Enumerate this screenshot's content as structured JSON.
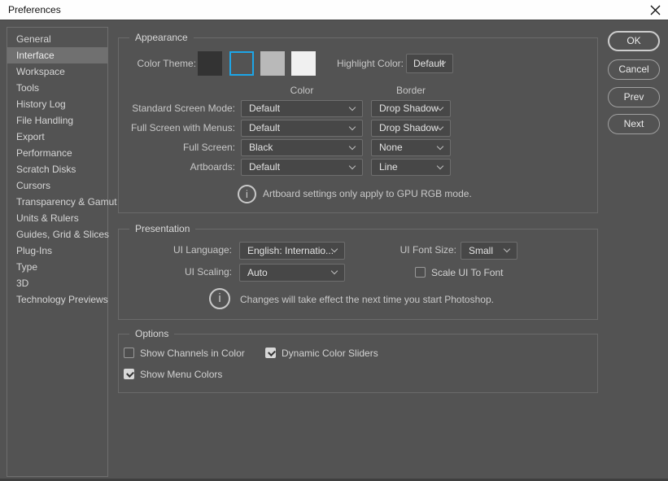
{
  "window": {
    "title": "Preferences"
  },
  "sidebar": {
    "items": [
      {
        "label": "General",
        "selected": false
      },
      {
        "label": "Interface",
        "selected": true
      },
      {
        "label": "Workspace",
        "selected": false
      },
      {
        "label": "Tools",
        "selected": false
      },
      {
        "label": "History Log",
        "selected": false
      },
      {
        "label": "File Handling",
        "selected": false
      },
      {
        "label": "Export",
        "selected": false
      },
      {
        "label": "Performance",
        "selected": false
      },
      {
        "label": "Scratch Disks",
        "selected": false
      },
      {
        "label": "Cursors",
        "selected": false
      },
      {
        "label": "Transparency & Gamut",
        "selected": false
      },
      {
        "label": "Units & Rulers",
        "selected": false
      },
      {
        "label": "Guides, Grid & Slices",
        "selected": false
      },
      {
        "label": "Plug-Ins",
        "selected": false
      },
      {
        "label": "Type",
        "selected": false
      },
      {
        "label": "3D",
        "selected": false
      },
      {
        "label": "Technology Previews",
        "selected": false
      }
    ]
  },
  "buttons": {
    "ok": "OK",
    "cancel": "Cancel",
    "prev": "Prev",
    "next": "Next"
  },
  "appearance": {
    "legend": "Appearance",
    "color_theme_label": "Color Theme:",
    "swatches": [
      "#333333",
      "#535353",
      "#b9b9b9",
      "#f0f0f0"
    ],
    "selected_swatch_index": 1,
    "selection_color": "#1da6e8",
    "highlight_color_label": "Highlight Color:",
    "highlight_color_value": "Default",
    "columns": {
      "color": "Color",
      "border": "Border"
    },
    "rows": [
      {
        "label": "Standard Screen Mode:",
        "color": "Default",
        "border": "Drop Shadow"
      },
      {
        "label": "Full Screen with Menus:",
        "color": "Default",
        "border": "Drop Shadow"
      },
      {
        "label": "Full Screen:",
        "color": "Black",
        "border": "None"
      },
      {
        "label": "Artboards:",
        "color": "Default",
        "border": "Line"
      }
    ],
    "info": "Artboard settings only apply to GPU RGB mode."
  },
  "presentation": {
    "legend": "Presentation",
    "ui_language_label": "UI Language:",
    "ui_language_value": "English: Internatio...",
    "ui_font_size_label": "UI Font Size:",
    "ui_font_size_value": "Small",
    "ui_scaling_label": "UI Scaling:",
    "ui_scaling_value": "Auto",
    "scale_ui_checkbox": {
      "label": "Scale UI To Font",
      "checked": false
    },
    "info": "Changes will take effect the next time you start Photoshop."
  },
  "options": {
    "legend": "Options",
    "checkboxes": [
      {
        "label": "Show Channels in Color",
        "checked": false
      },
      {
        "label": "Dynamic Color Sliders",
        "checked": true
      },
      {
        "label": "Show Menu Colors",
        "checked": true
      }
    ]
  },
  "icons": {
    "info_glyph": "i"
  },
  "colors": {
    "dialog_bg": "#535353",
    "titlebar_bg": "#fefefe",
    "accent_blue": "#1da6e8",
    "groupbox_border": "#6a6a6a"
  }
}
